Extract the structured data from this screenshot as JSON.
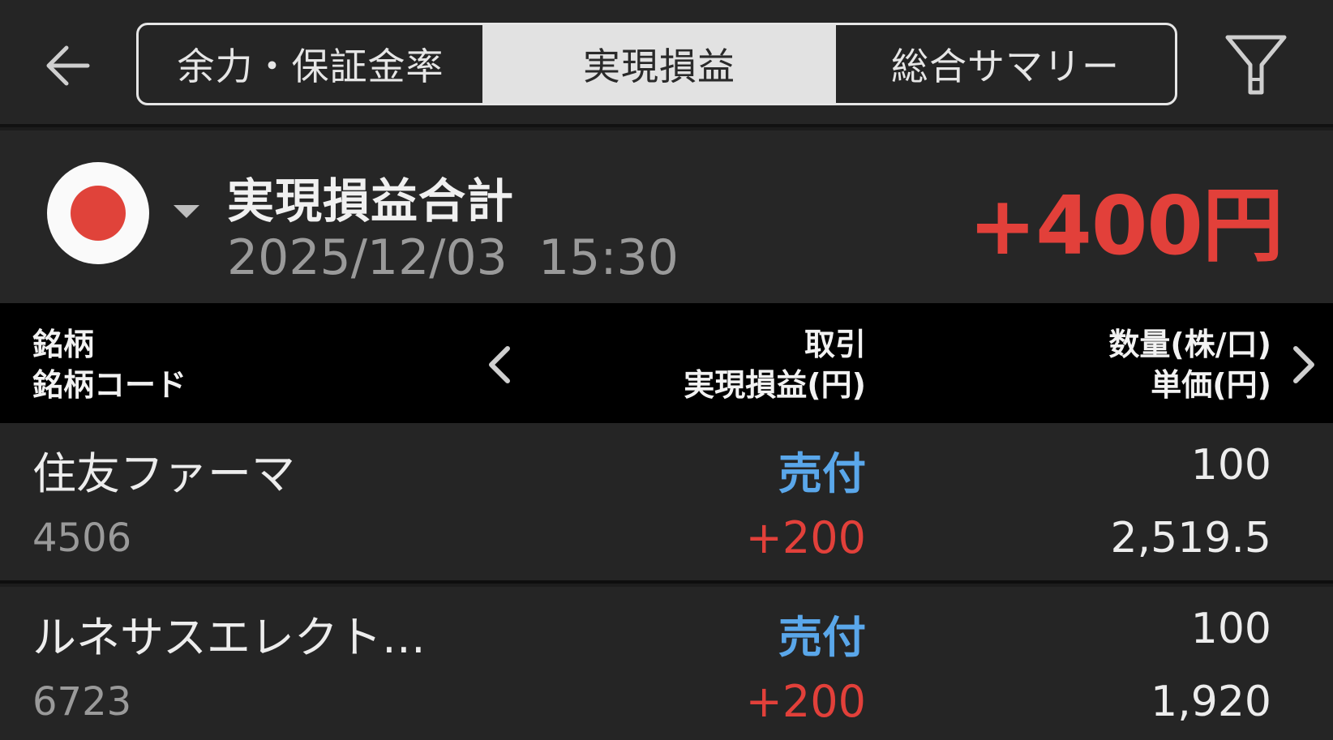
{
  "tabs": [
    {
      "label": "余力・保証金率",
      "active": false
    },
    {
      "label": "実現損益",
      "active": true
    },
    {
      "label": "総合サマリー",
      "active": false
    }
  ],
  "icons": {
    "back": "arrow-left-icon",
    "filter": "filter-icon",
    "market": "japan-flag-icon",
    "caret": "caret-down-icon",
    "prev": "chevron-left-icon",
    "next": "chevron-right-icon"
  },
  "summary": {
    "title": "実現損益合計",
    "datetime": "2025/12/03  15:30",
    "total": "+400円"
  },
  "columns": {
    "left_line1": "銘柄",
    "left_line2": "銘柄コード",
    "mid_line1": "取引",
    "mid_line2": "実現損益(円)",
    "right_line1": "数量(株/口)",
    "right_line2": "単価(円)"
  },
  "rows": [
    {
      "name": "住友ファーマ",
      "code": "4506",
      "trade": "売付",
      "pl": "+200",
      "qty": "100",
      "price": "2,519.5"
    },
    {
      "name": "ルネサスエレクト…",
      "code": "6723",
      "trade": "売付",
      "pl": "+200",
      "qty": "100",
      "price": "1,920"
    }
  ],
  "colors": {
    "profit": "#e2403a",
    "sell": "#5aa7ea",
    "background": "#1c1c1c"
  }
}
